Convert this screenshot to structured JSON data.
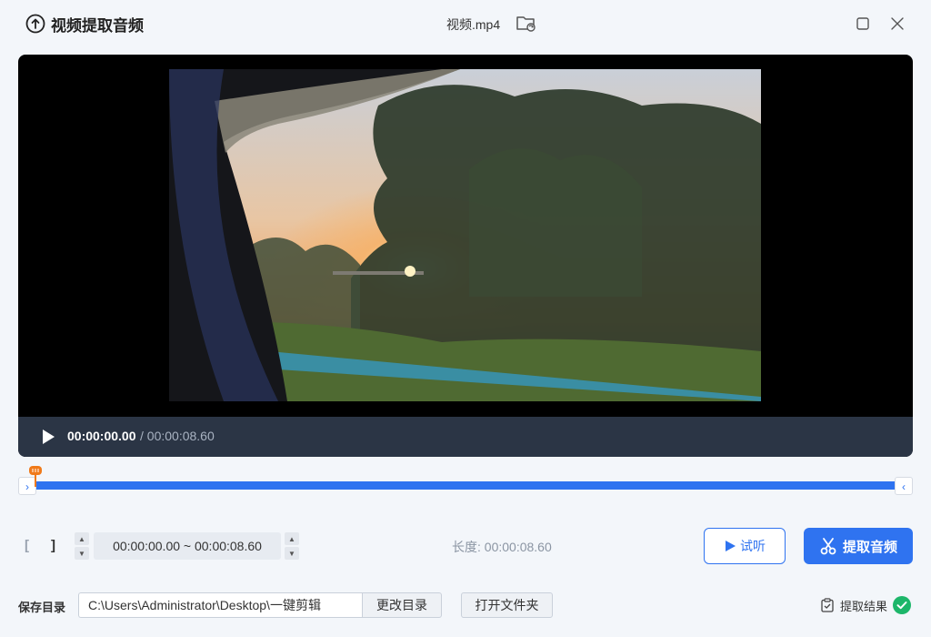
{
  "header": {
    "app_title": "视频提取音频",
    "file_name": "视频.mp4"
  },
  "player": {
    "current_time": "00:00:00.00",
    "total_time": "/ 00:00:08.60"
  },
  "range": {
    "start_bracket": "[",
    "end_bracket": "]",
    "value": "00:00:00.00 ~ 00:00:08.60",
    "length_text": "长度: 00:00:08.60"
  },
  "actions": {
    "listen_label": "试听",
    "extract_label": "提取音频"
  },
  "save": {
    "label": "保存目录",
    "path": "C:\\Users\\Administrator\\Desktop\\一键剪辑",
    "change_label": "更改目录",
    "open_label": "打开文件夹",
    "result_label": "提取结果"
  },
  "colors": {
    "accent": "#2f73f0",
    "success": "#1db66a",
    "marker": "#f07a1a",
    "control_bar": "#2b3545"
  },
  "icons": [
    "upload-circle-icon",
    "folder-refresh-icon",
    "maximize-icon",
    "close-icon",
    "play-icon",
    "scissors-icon",
    "clipboard-check-icon",
    "check-circle-icon"
  ]
}
